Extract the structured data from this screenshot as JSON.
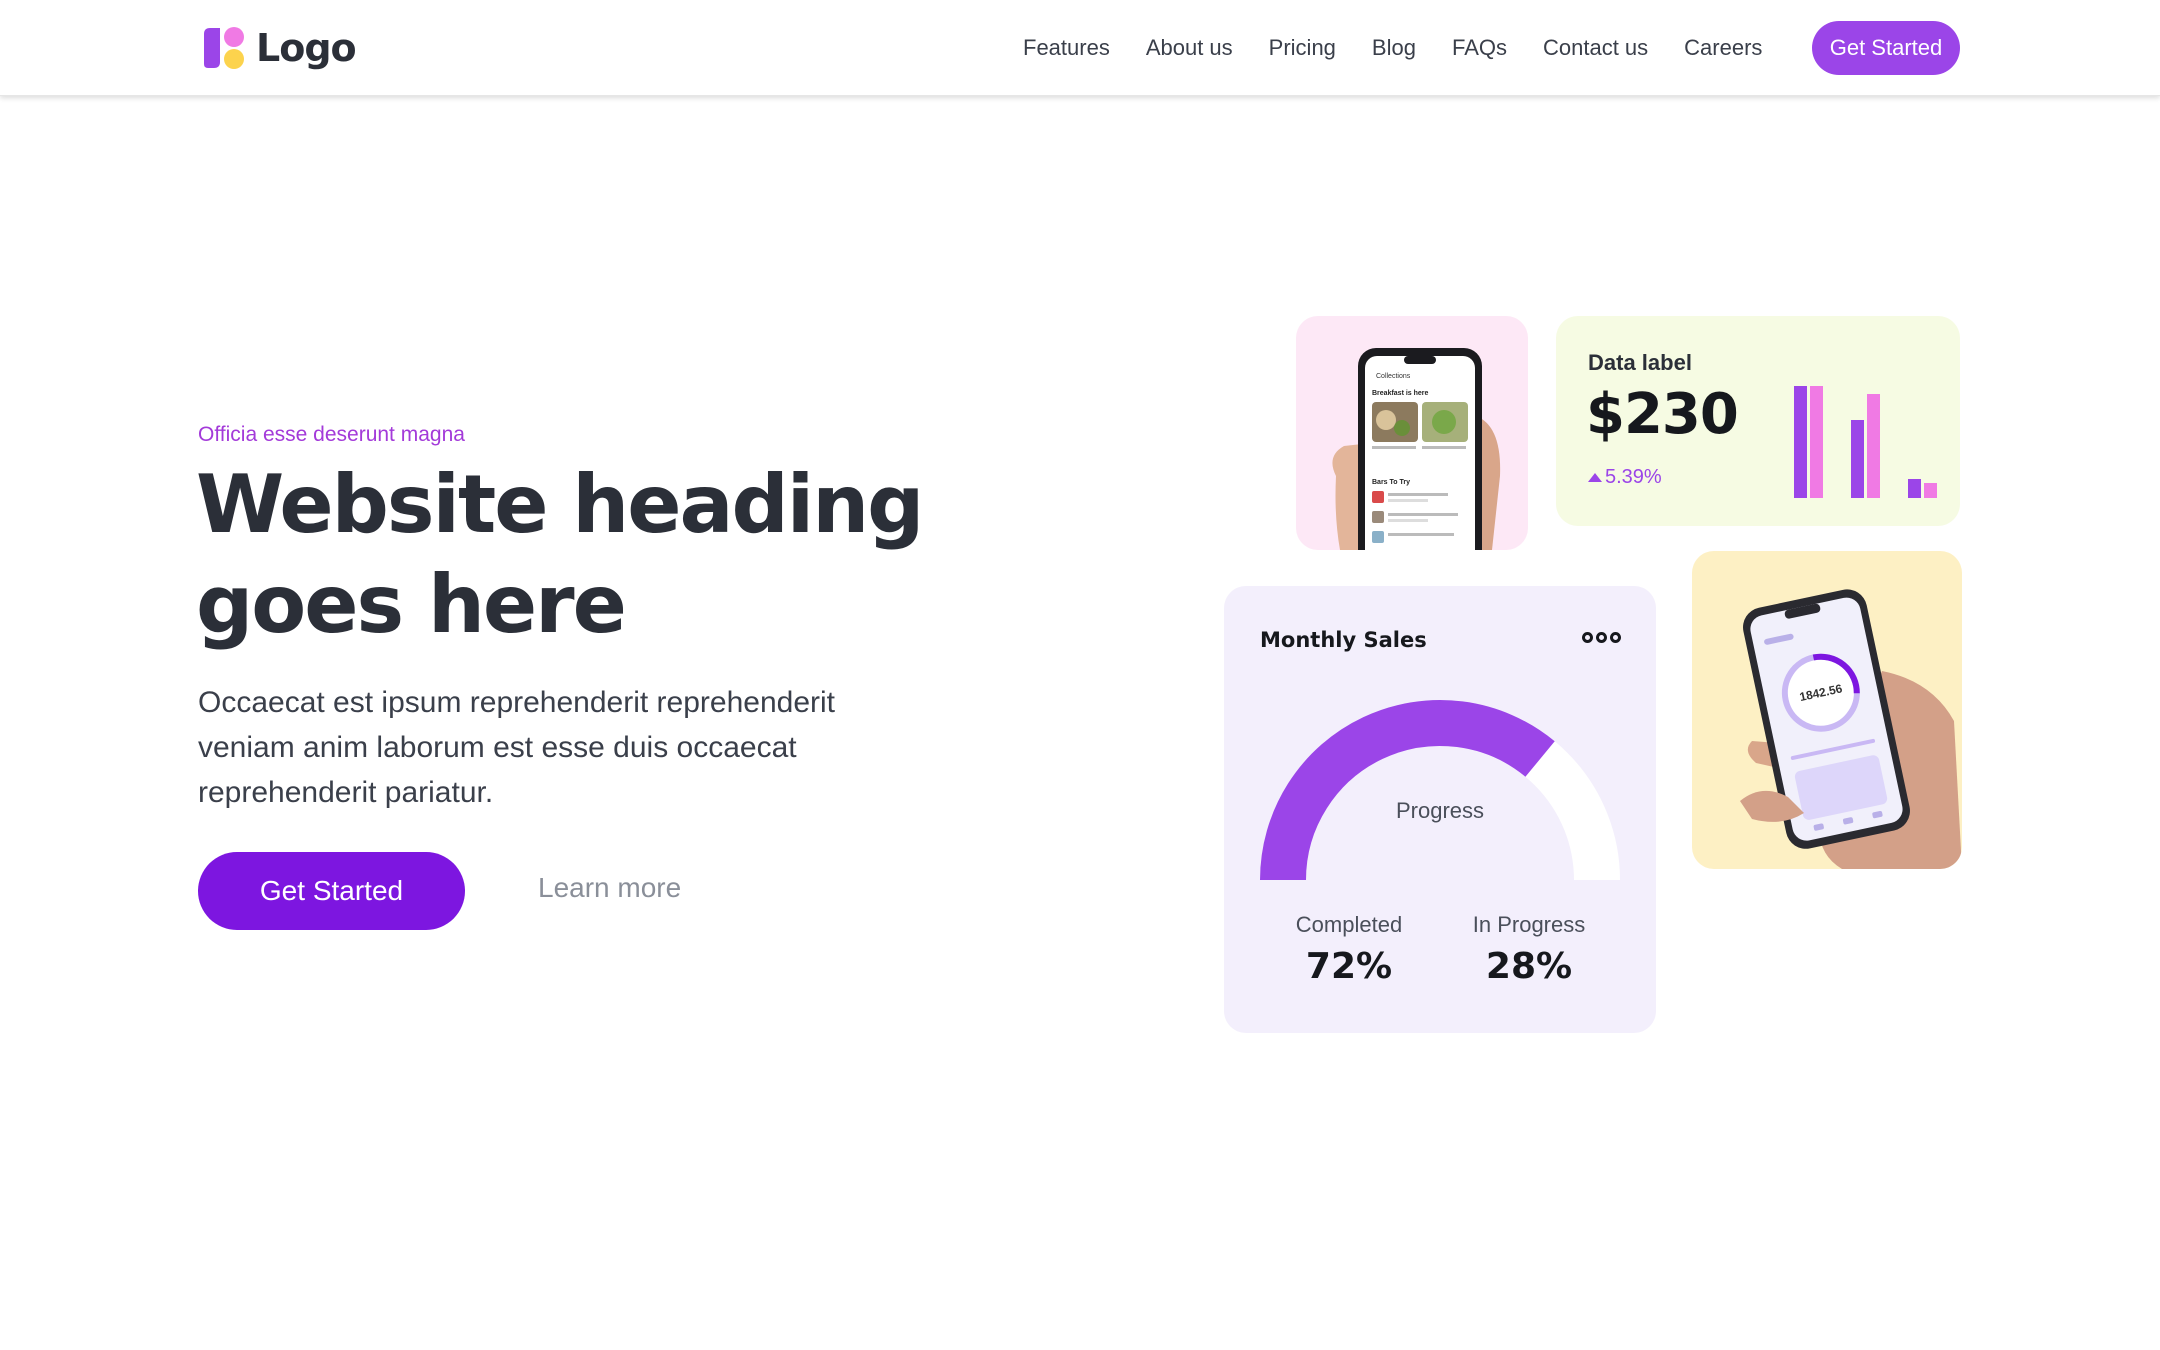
{
  "header": {
    "logo_text": "Logo",
    "nav": [
      "Features",
      "About us",
      "Pricing",
      "Blog",
      "FAQs",
      "Contact us",
      "Careers"
    ],
    "cta_label": "Get Started"
  },
  "hero": {
    "eyebrow": "Officia esse deserunt magna",
    "heading": "Website heading goes here",
    "lead": "Occaecat est ipsum reprehenderit reprehenderit veniam anim laborum est esse duis occaecat reprehenderit pariatur.",
    "primary_label": "Get Started",
    "secondary_label": "Learn more"
  },
  "data_card": {
    "label": "Data label",
    "value": "$230",
    "change": "5.39%",
    "change_direction": "up",
    "bars": [
      {
        "purple": 1.0,
        "pink": 1.0
      },
      {
        "purple": 0.7,
        "pink": 0.93
      },
      {
        "purple": 0.17,
        "pink": 0.13
      }
    ]
  },
  "sales_card": {
    "title": "Monthly Sales",
    "gauge_label": "Progress",
    "progress_fraction": 0.72,
    "completed_label": "Completed",
    "completed_value": "72%",
    "in_progress_label": "In Progress",
    "in_progress_value": "28%"
  },
  "phone_card_1": {
    "app_back": "Collections",
    "section_1": "Breakfast is here",
    "section_2": "Bars To Try"
  },
  "phone_card_2": {
    "reading": "1842.56"
  },
  "colors": {
    "brand_purple": "#9b45e8",
    "primary_button": "#7d16e0",
    "accent_pink": "#f07ae4",
    "eyebrow": "#a33ad9"
  },
  "icons": [
    "logo-mark-icon",
    "arrow-up-icon",
    "more-dots-icon"
  ]
}
